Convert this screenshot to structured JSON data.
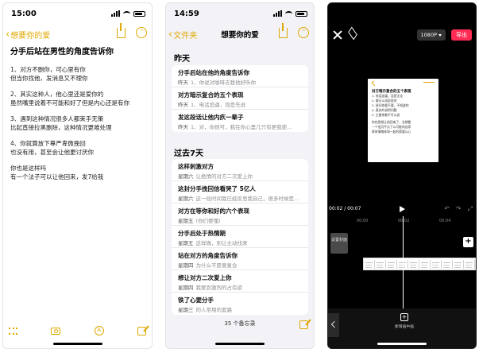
{
  "screen1": {
    "time": "15:00",
    "back_label": "想要你的爱",
    "note_title": "分手后站在男性的角度告诉你",
    "note_lines": [
      "1、对方不删你，可心里有你",
      "但当你找他，发消息又不理你",
      "",
      "2、其实这种人，他心里还是爱你的",
      "虽然嘴里说着不可能和好了但是内心还是有你",
      "",
      "3、遇到这种情况很多人都束手无策",
      "比起直接拉黑删除，这种情况更难处理",
      "",
      "4、你就算放下尊严卑微挽回",
      "也没有用，甚至会让他更讨厌你",
      "",
      "你也是这样吗",
      "有一个法子可以让他回来，发7给我"
    ]
  },
  "screen2": {
    "time": "14:59",
    "back_label": "文件夹",
    "title": "想要你的爱",
    "section_yesterday": "昨天",
    "section_week": "过去7天",
    "yesterday_items": [
      {
        "title": "分手后站在他的角度告诉你",
        "date": "昨天",
        "preview": "1、你说对咖啡去我他好听你"
      },
      {
        "title": "对方暗示复合的五个表现",
        "date": "昨天",
        "preview": "1、电话追逼，泡是先说"
      },
      {
        "title": "发这段话让他内疚一辈子",
        "date": "昨天",
        "preview": "1、对，你很可，我在你心里几只有更我使..."
      }
    ],
    "week_items": [
      {
        "title": "这样刺激对方",
        "date": "星期六",
        "preview": "让绝情的对方二次爱上你"
      },
      {
        "title": "这封分手挽回信看哭了 5亿人",
        "date": "星期六",
        "preview": "这一段时间我已经反思我自己，很多时候是..."
      },
      {
        "title": "对方在等你和好的六个表现",
        "date": "星期五",
        "preview": "(你们要懂)"
      },
      {
        "title": "分手后处于热情期",
        "date": "星期五",
        "preview": "这样做，别让主动找来"
      },
      {
        "title": "站在对方的角度告诉你",
        "date": "星期四",
        "preview": "为什么不愿意复合"
      },
      {
        "title": "想让对方二次爱上你",
        "date": "星期四",
        "preview": "我要到激烈的占有欲"
      },
      {
        "title": "铁了心要分手",
        "date": "星期三",
        "preview": "的人常用的套路"
      }
    ],
    "notes_count": "35 个备忘录"
  },
  "screen3": {
    "resolution": "1080P",
    "export_label": "导出",
    "preview_title": "对方暗示复合的五个表现",
    "preview_lines": [
      "1. 电话追逼，没是无论",
      "2. 聊天斗成说说你",
      "3. 经问你要不要，不知道的",
      "4. 真实的说明问题",
      "5. 主要带着不可以说",
      "",
      "你也是想让他回来了，长期看",
      "一个低沉平点了以可能的自家",
      "联系情绪体和一起的需要以心"
    ],
    "time_display": "00:02 / 00:07",
    "ruler_marks": [
      "00:00",
      "00:02",
      "00:04"
    ],
    "track_label": "设置封面",
    "tool_label": "新增画中画"
  }
}
